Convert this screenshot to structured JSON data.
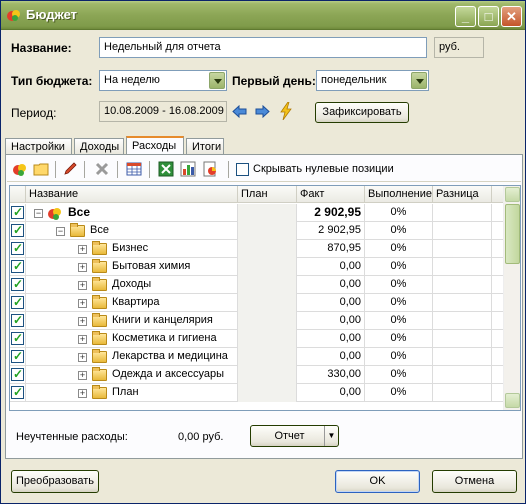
{
  "window": {
    "title": "Бюджет"
  },
  "form": {
    "name_label": "Название:",
    "name_value": "Недельный для отчета",
    "currency": "руб.",
    "budget_type_label": "Тип бюджета:",
    "budget_type_value": "На неделю",
    "first_day_label": "Первый день:",
    "first_day_value": "понедельник",
    "period_label": "Период:",
    "period_value": "10.08.2009 - 16.08.2009",
    "fix_button": "Зафиксировать"
  },
  "tabs": [
    {
      "label": "Настройки"
    },
    {
      "label": "Доходы"
    },
    {
      "label": "Расходы",
      "active": true
    },
    {
      "label": "Итоги"
    }
  ],
  "toolbar": {
    "hide_zero_label": "Скрывать нулевые позиции"
  },
  "grid": {
    "columns": [
      "Название",
      "План",
      "Факт",
      "Выполнение",
      "Разница"
    ],
    "rows": [
      {
        "name": "Все",
        "plan": "",
        "fact": "2 902,95",
        "perf": "0%",
        "diff": "",
        "level": 0,
        "bold": true
      },
      {
        "name": "Все",
        "plan": "",
        "fact": "2 902,95",
        "perf": "0%",
        "diff": "",
        "level": 1
      },
      {
        "name": "Бизнес",
        "plan": "",
        "fact": "870,95",
        "perf": "0%",
        "diff": "",
        "level": 2
      },
      {
        "name": "Бытовая химия",
        "plan": "",
        "fact": "0,00",
        "perf": "0%",
        "diff": "",
        "level": 2
      },
      {
        "name": "Доходы",
        "plan": "",
        "fact": "0,00",
        "perf": "0%",
        "diff": "",
        "level": 2
      },
      {
        "name": "Квартира",
        "plan": "",
        "fact": "0,00",
        "perf": "0%",
        "diff": "",
        "level": 2
      },
      {
        "name": "Книги и канцелярия",
        "plan": "",
        "fact": "0,00",
        "perf": "0%",
        "diff": "",
        "level": 2
      },
      {
        "name": "Косметика и гигиена",
        "plan": "",
        "fact": "0,00",
        "perf": "0%",
        "diff": "",
        "level": 2
      },
      {
        "name": "Лекарства и медицина",
        "plan": "",
        "fact": "0,00",
        "perf": "0%",
        "diff": "",
        "level": 2
      },
      {
        "name": "Одежда и аксессуары",
        "plan": "",
        "fact": "330,00",
        "perf": "0%",
        "diff": "",
        "level": 2
      },
      {
        "name": "План",
        "plan": "",
        "fact": "0,00",
        "perf": "0%",
        "diff": "",
        "level": 2
      }
    ]
  },
  "footer": {
    "unaccounted_label": "Неучтенные расходы:",
    "unaccounted_value": "0,00 руб.",
    "report_button": "Отчет",
    "convert_button": "Преобразовать",
    "ok_button": "OK",
    "cancel_button": "Отмена"
  },
  "colors": {
    "titlebar": "#8ca656",
    "active_tab_accent": "#e68b2c",
    "check": "#21a121"
  }
}
